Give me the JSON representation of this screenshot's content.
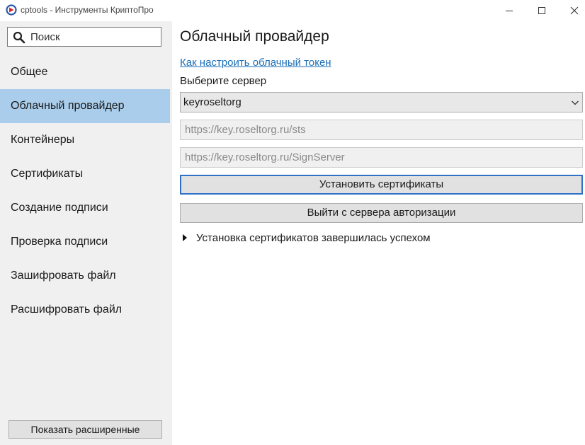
{
  "window": {
    "title": "cptools - Инструменты КриптоПро",
    "app_icon": "cryptopro-logo-icon",
    "controls": [
      "minimize-icon",
      "maximize-icon",
      "close-icon"
    ]
  },
  "sidebar": {
    "search_placeholder": "Поиск",
    "search_value": "",
    "items": [
      {
        "label": "Общее",
        "active": false
      },
      {
        "label": "Облачный провайдер",
        "active": true
      },
      {
        "label": "Контейнеры",
        "active": false
      },
      {
        "label": "Сертификаты",
        "active": false
      },
      {
        "label": "Создание подписи",
        "active": false
      },
      {
        "label": "Проверка подписи",
        "active": false
      },
      {
        "label": "Зашифровать файл",
        "active": false
      },
      {
        "label": "Расшифровать файл",
        "active": false
      }
    ],
    "advanced_button": "Показать расширенные"
  },
  "main": {
    "title": "Облачный провайдер",
    "help_link": "Как настроить облачный токен",
    "server_label": "Выберите сервер",
    "server_selected": "keyroseltorg",
    "auth_url": "https://key.roseltorg.ru/sts",
    "sign_url": "https://key.roseltorg.ru/SignServer",
    "install_button": "Установить сертификаты",
    "logout_button": "Выйти с сервера авторизации",
    "status_text": "Установка сертификатов завершилась успехом"
  },
  "colors": {
    "sidebar_bg": "#f0f0f0",
    "active_item": "#a9cdeb",
    "link": "#1a6fb8",
    "focus_border": "#2f71c6"
  }
}
